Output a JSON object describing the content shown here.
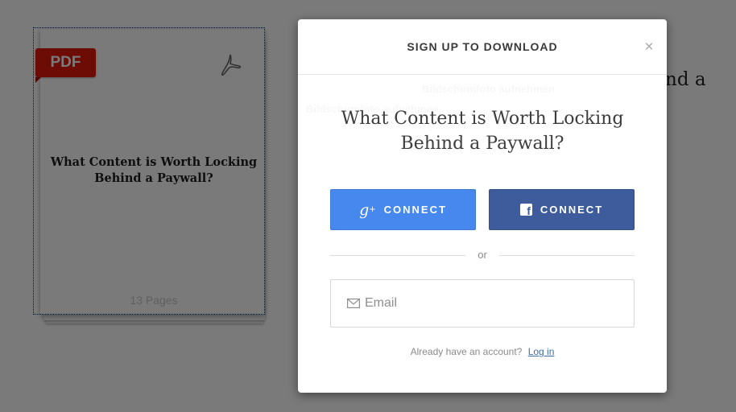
{
  "background": {
    "partial_text": "nd a"
  },
  "document_card": {
    "badge_label": "PDF",
    "icon": "acrobat-icon",
    "title": "What Content is Worth Locking Behind a Paywall?",
    "pages_label": "13 Pages"
  },
  "modal": {
    "title": "SIGN UP TO DOWNLOAD",
    "close_icon": "close-icon",
    "close_glyph": "×",
    "headline_line1": "What Content is Worth Locking",
    "headline_line2": "Behind a Paywall?",
    "buttons": [
      {
        "provider": "google-plus",
        "label": "CONNECT",
        "icon": "google-plus-icon",
        "color": "#4688ee"
      },
      {
        "provider": "facebook",
        "label": "CONNECT",
        "icon": "facebook-icon",
        "color": "#3e5c9b"
      }
    ],
    "divider_text": "or",
    "email": {
      "placeholder": "Email",
      "value": "",
      "icon": "envelope-icon"
    },
    "footer": {
      "prompt": "Already have an account?",
      "link_label": "Log in"
    }
  },
  "ghost_overlay": {
    "title": "Bildschirmfoto aufnehmen",
    "subtitle": "Bildschirmfoto aufnehmen"
  }
}
